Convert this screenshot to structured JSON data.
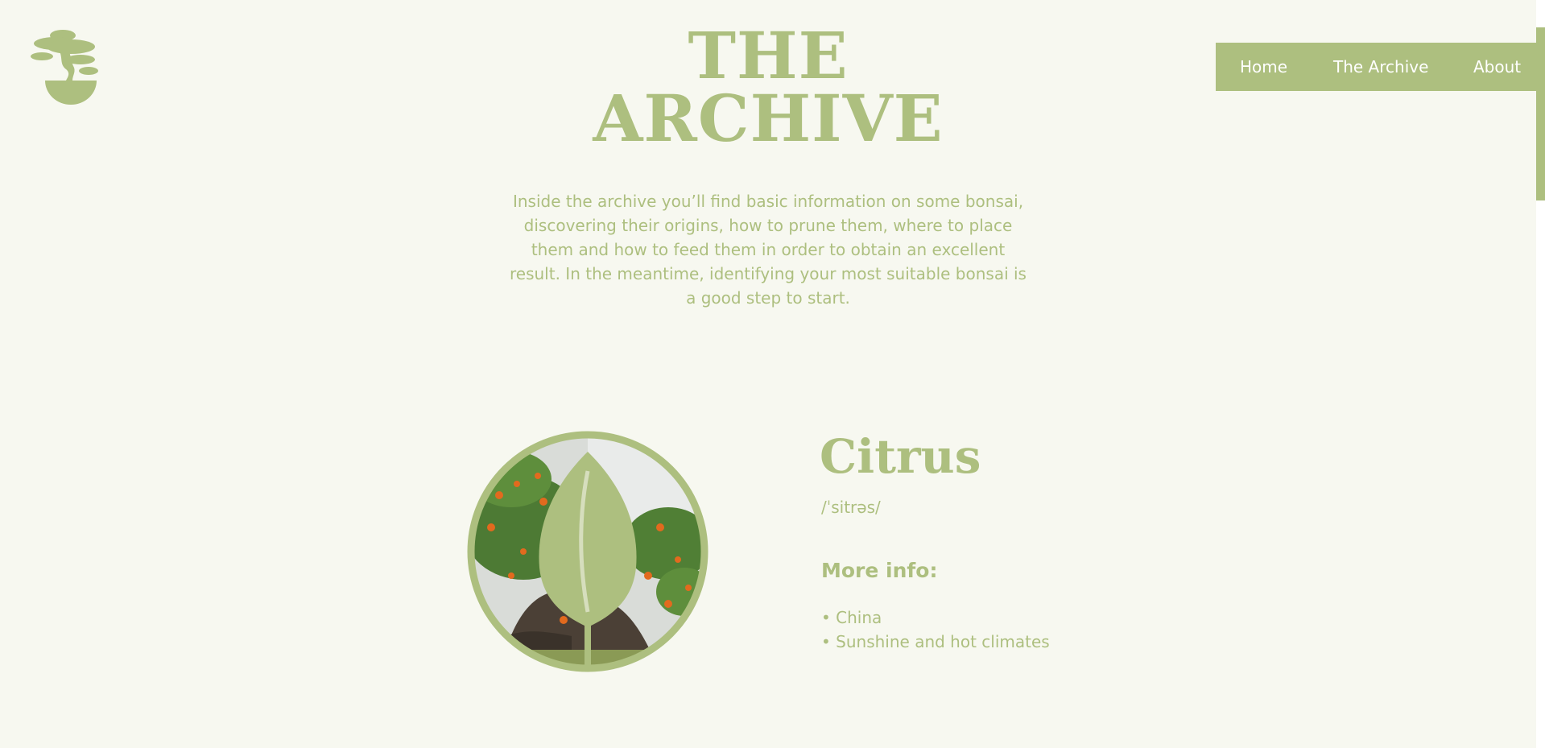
{
  "header": {
    "logo_icon": "bonsai-tree-icon",
    "title_line1": "THE",
    "title_line2": "ARCHIVE"
  },
  "nav": {
    "items": [
      {
        "label": "Home"
      },
      {
        "label": "The Archive"
      },
      {
        "label": "About"
      }
    ]
  },
  "intro": {
    "text": "Inside the archive you’ll find basic information on some bonsai, discovering their origins, how to prune them, where to place them and how to feed them in order to obtain an excellent result. In the meantime, identifying your most suitable bonsai is a good step to start."
  },
  "specimen": {
    "name": "Citrus",
    "phonetic": "/ˈsitrəs/",
    "more_info_label": "More info:",
    "facts": [
      "• China",
      "• Sunshine and hot climates"
    ],
    "image_icon": "leaf-icon"
  },
  "colors": {
    "background": "#f7f8f0",
    "accent": "#adbf7f",
    "nav_text": "#ffffff"
  }
}
